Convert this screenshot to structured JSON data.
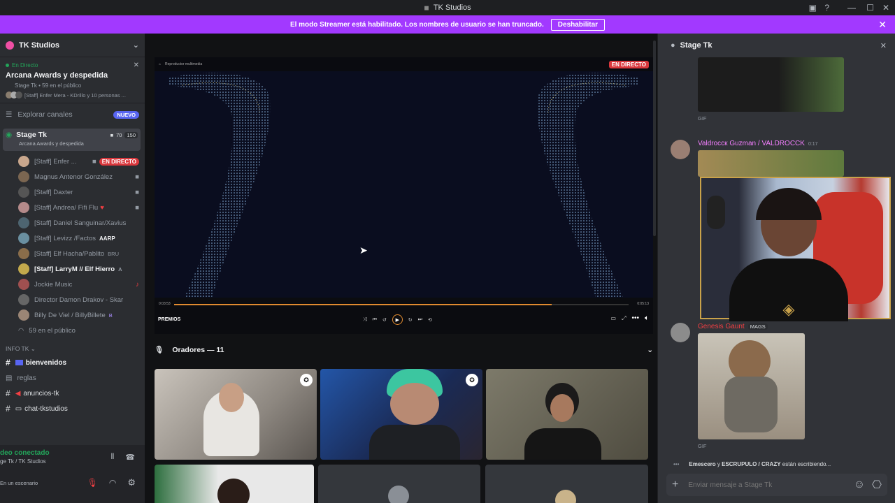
{
  "window": {
    "title": "TK Studios"
  },
  "banner": {
    "text": "El modo Streamer está habilitado. Los nombres de usuario se han truncado.",
    "button": "Deshabilitar"
  },
  "sidebar": {
    "server_name": "TK Studios",
    "live": {
      "status": "En Directo",
      "title": "Arcana Awards y despedida",
      "meta": "Stage Tk • 59 en el público",
      "speakers": "[Staff] Enfer Mera - KDrillo y 10 personas ..."
    },
    "explore": {
      "label": "Explorar canales",
      "badge": "NUEVO"
    },
    "stage": {
      "name": "Stage Tk",
      "topic": "Arcana Awards y despedida",
      "video_count": "70",
      "listeners": "150"
    },
    "members": [
      {
        "name": "[Staff] Enfer ...",
        "tag": "EN DIRECTO"
      },
      {
        "name": "Magnus Antenor González",
        "tag": ""
      },
      {
        "name": "[Staff] Daxter",
        "tag": ""
      },
      {
        "name": "[Staff] Andrea/ Fifi Flu",
        "tag": ""
      },
      {
        "name": "[Staff] Daniel Sanguinar/Xavius",
        "tag": ""
      },
      {
        "name": "[Staff] Levizz /Factos",
        "tag": "AARP"
      },
      {
        "name": "[Staff] Elf Hacha/Pablito",
        "tag": "BRU"
      },
      {
        "name": "[Staff] LarryM // Elf Hierro",
        "tag": "A"
      },
      {
        "name": "Jockie Music",
        "tag": ""
      },
      {
        "name": "Director Damon Drakov - Skar",
        "tag": ""
      },
      {
        "name": "Billy De Viel / BillyBillete",
        "tag": "B"
      }
    ],
    "audience": "59 en el público",
    "category": "INFO TK",
    "channels": [
      "bienvenidos",
      "reglas",
      "anuncios-tk",
      "chat-tkstudios"
    ],
    "voice": {
      "status": "deo conectado",
      "location": "ge Tk / TK Studios",
      "user_status": "En un escenario"
    }
  },
  "stage": {
    "live_badge": "EN DIRECTO",
    "breadcrumb": "Reproductor multimedia",
    "player_label": "PREMIOS",
    "time_start": "0:03:53",
    "time_end": "0:05:13",
    "progress_pct": 0.83,
    "speakers_header": "Oradores — 11"
  },
  "right": {
    "title": "Stage Tk",
    "gif_label_1": "GIF",
    "msg1": {
      "author": "Valdroccк Guzman / VALDROCCK",
      "time": "0:17"
    },
    "msg2": {
      "author": "Genesis Gaunt",
      "tag": "MAGS"
    },
    "gif_label_2": "GIF",
    "typing": "Emescero y ESCRUPULO / CRAZY están escribiendo...",
    "typing_a": "Emescero",
    "typing_and": " y ",
    "typing_b": "ESCRUPULO / CRAZY",
    "typing_rest": " están escribiendo...",
    "input_placeholder": "Enviar mensaje a Stage Tk"
  }
}
